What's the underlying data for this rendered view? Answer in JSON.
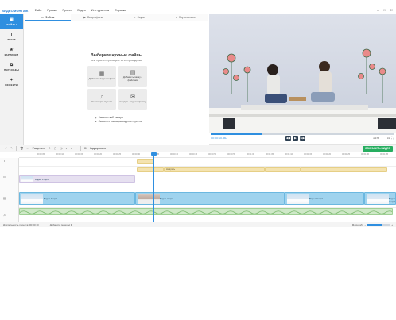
{
  "app": {
    "logo": "ВИДЕОМОНТАЖ",
    "menu": [
      "Файл",
      "Правка",
      "Проект",
      "Видео",
      "Инструменты",
      "Справка"
    ],
    "window_controls": [
      "–",
      "□",
      "✕"
    ]
  },
  "sidebar": {
    "items": [
      {
        "label": "ФАЙЛЫ",
        "icon": "files-icon",
        "glyph": "▣",
        "active": true
      },
      {
        "label": "ТЕКСТ",
        "icon": "text-icon",
        "glyph": "T",
        "active": false
      },
      {
        "label": "КАРТИНКИ",
        "icon": "images-icon",
        "glyph": "★",
        "active": false
      },
      {
        "label": "ПЕРЕХОДЫ",
        "icon": "transitions-icon",
        "glyph": "⧉",
        "active": false
      },
      {
        "label": "ЭФФЕКТЫ",
        "icon": "effects-icon",
        "glyph": "✦",
        "active": false
      }
    ]
  },
  "tabs": [
    {
      "label": "Файлы",
      "icon": "folder-icon",
      "glyph": "▭",
      "active": true
    },
    {
      "label": "Видеофоны",
      "icon": "video-bg-icon",
      "glyph": "▶",
      "active": false
    },
    {
      "label": "Звуки",
      "icon": "sounds-icon",
      "glyph": "♪",
      "active": false
    },
    {
      "label": "Звукозапись",
      "icon": "mic-icon",
      "glyph": "●",
      "active": false
    }
  ],
  "content": {
    "title": "Выберите нужные файлы",
    "subtitle": "или просто перетащите их из проводника",
    "tiles": [
      {
        "label": "Добавить видео и фото",
        "icon": "add-media-icon",
        "glyph": "▦"
      },
      {
        "label": "Добавить папку с файлами",
        "icon": "add-folder-icon",
        "glyph": "▤"
      },
      {
        "label": "Коллекция музыки",
        "icon": "music-icon",
        "glyph": "♫"
      },
      {
        "label": "Создать видеооткрытку",
        "icon": "postcard-icon",
        "glyph": "✉"
      }
    ],
    "links": [
      {
        "label": "Запись с веб-камеры",
        "icon": "webcam-icon"
      },
      {
        "label": "Скачать с помощью видеоинтернета",
        "icon": "download-icon"
      }
    ]
  },
  "preview": {
    "timecode": "00:00:10.867",
    "progress": 0.28,
    "aspect": "16:9",
    "buttons": [
      "◀◀",
      "▶",
      "▶▶"
    ]
  },
  "toolbar": {
    "split_label": "Разделить",
    "crop_label": "Кадрировать",
    "save_label": "СОХРАНИТЬ ВИДЕО"
  },
  "timeline": {
    "ticks": [
      "00:00:05",
      "00:00:10",
      "00:00:15",
      "00:00:20",
      "00:00:25",
      "00:00:30",
      "00:00:35",
      "00:00:40",
      "00:00:45",
      "00:00:50",
      "00:00:55",
      "00:01:00",
      "00:01:05",
      "00:01:10",
      "00:01:15",
      "00:01:20",
      "00:01:25",
      "00:01:30",
      "00:01:35"
    ],
    "yellow_clips": [
      "Надпись",
      "Фото",
      "Фото"
    ],
    "title_clip_label": "Видео 1.mp4",
    "video_clips": [
      "Видео 1.mp4",
      "Видео 2.mp4",
      "Видео 3.mp4",
      "Видео 4.mp4"
    ]
  },
  "status": {
    "project_duration": "Длительность проекта: 00:00:10",
    "add_transition": "Добавить переход ▾",
    "zoom_label": "Масштаб:"
  },
  "colors": {
    "accent": "#2f8fe0",
    "save": "#27ae60",
    "video_clip": "#9fd3ee",
    "audio_clip": "#cfe9c8",
    "text_clip": "#f4e3b0"
  }
}
